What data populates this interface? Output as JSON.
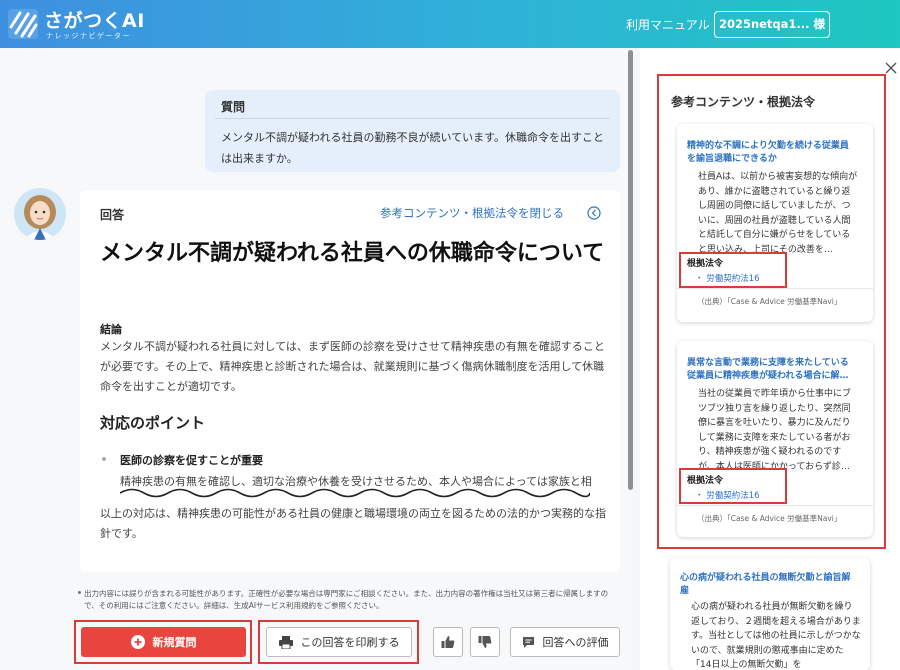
{
  "header": {
    "logo_name": "さがつくAI",
    "logo_sub": "ナレッジナビゲーター",
    "manual_link": "利用マニュアル",
    "user_button": "2025netqa1... 様"
  },
  "question": {
    "label": "質問",
    "text": "メンタル不調が疑われる社員の勤務不良が続いています。休職命令を出すことは出来ますか。"
  },
  "answer": {
    "label": "回答",
    "close_refs": "参考コンテンツ・根拠法令を閉じる",
    "title": "メンタル不調が疑われる社員への休職命令について",
    "conclusion_heading": "結論",
    "conclusion_text": "メンタル不調が疑われる社員に対しては、まず医師の診察を受けさせて精神疾患の有無を確認することが必要です。その上で、精神疾患と診断された場合は、就業規則に基づく傷病休職制度を活用して休職命令を出すことが適切です。",
    "points_heading": "対応のポイント",
    "point1_title": "医師の診察を促すことが重要",
    "point1_text": "精神疾患の有無を確認し、適切な治療や休養を受けさせるため、本人や場合によっては家族と相",
    "closing_text": "以上の対応は、精神疾患の可能性がある社員の健康と職場環境の両立を図るための法的かつ実務的な指針です。"
  },
  "disclaimer": "出力内容には誤りが含まれる可能性があります。正確性が必要な場合は専門家にご相談ください。また、出力内容の著作権は当社又は第三者に帰属しますので、その利用にはご注意ください。詳細は、生成AIサービス利用規約をご参照ください。",
  "actions": {
    "new_question": "新規質問",
    "print": "この回答を印刷する",
    "evaluate": "回答への評価"
  },
  "panel": {
    "title": "参考コンテンツ・根拠法令",
    "cards": [
      {
        "title": "精神的な不調により欠勤を続ける従業員を諭旨退職にできるか",
        "body": "社員Aは、以前から被害妄想的な傾向があり、誰かに盗聴されていると繰り返し周囲の同僚に話していましたが、ついに、周囲の社員が盗聴している人間と結託して自分に嫌がらせをしていると思い込み、上司にその改善を…",
        "law_label": "根拠法令",
        "law": "・ 労働契約法16",
        "source": "（出典）「Case & Advice 労働基準Navi」"
      },
      {
        "title": "異常な言動で業務に支障を来たしている従業員に精神疾患が疑われる場合に解…",
        "body": "当社の従業員で昨年頃から仕事中にブツブツ独り言を繰り返したり、突然同僚に暴言を吐いたり、暴力に及んだりして業務に支障を来たしている者がおり、精神疾患が強く疑われるのですが、本人は医師にかかっておらず診…",
        "law_label": "根拠法令",
        "law": "・ 労働契約法16",
        "source": "（出典）「Case & Advice 労働基準Navi」"
      },
      {
        "title": "心の病が疑われる社員の無断欠勤と諭旨解雇",
        "body": "心の病が疑われる社員が無断欠勤を繰り返しており、２週間を超える場合があります。当社としては他の社員に示しがつかないので、就業規則の懲戒事由に定めた「14日以上の無断欠勤」を"
      }
    ]
  },
  "colors": {
    "accent_blue": "#2d72c4",
    "new_button": "#e8453e",
    "highlight_frame": "#d93a3a"
  }
}
